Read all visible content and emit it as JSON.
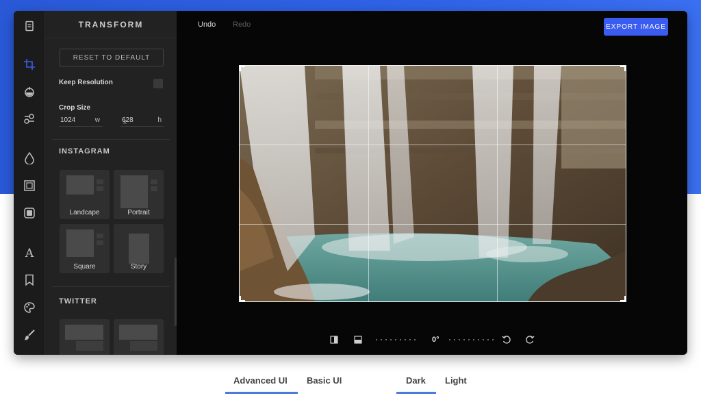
{
  "panel": {
    "title": "TRANSFORM",
    "reset_label": "RESET TO DEFAULT",
    "keep_resolution_label": "Keep Resolution",
    "crop_size_label": "Crop Size",
    "width_value": "1024",
    "width_unit": "w",
    "separator": "x",
    "height_value": "628",
    "height_unit": "h",
    "instagram": {
      "heading": "INSTAGRAM",
      "presets": [
        "Landcape",
        "Portrait",
        "Square",
        "Story"
      ]
    },
    "twitter": {
      "heading": "TWITTER"
    }
  },
  "toolbar": {
    "undo_label": "Undo",
    "redo_label": "Redo",
    "export_label": "EXPORT IMAGE"
  },
  "rotation": {
    "angle": "0°"
  },
  "page_toggles": {
    "ui_options": [
      "Advanced UI",
      "Basic UI"
    ],
    "ui_selected": "Advanced UI",
    "theme_options": [
      "Dark",
      "Light"
    ],
    "theme_selected": "Dark"
  },
  "rail_icons": [
    "document-icon",
    "crop-icon",
    "filter-icon",
    "adjust-icon",
    "drop-icon",
    "frame-icon",
    "corners-icon",
    "text-icon",
    "sticker-icon",
    "palette-icon",
    "brush-icon"
  ],
  "colors": {
    "accent": "#3b5cf0",
    "rail_active": "#3b5cf0",
    "toggle_underline": "#4a7bd8"
  }
}
